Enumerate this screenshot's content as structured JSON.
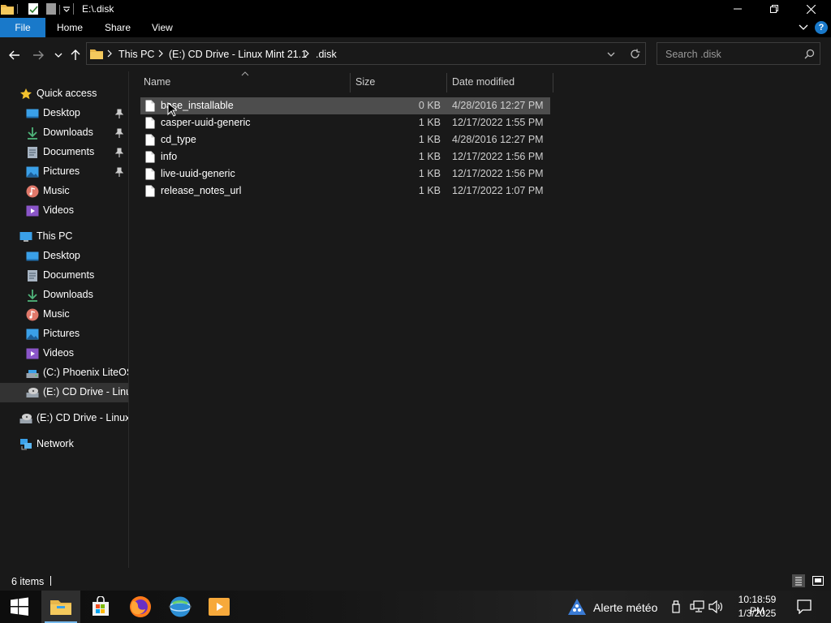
{
  "window": {
    "title": "E:\\.disk"
  },
  "ribbon": {
    "tabs": [
      {
        "label": "File"
      },
      {
        "label": "Home"
      },
      {
        "label": "Share"
      },
      {
        "label": "View"
      }
    ],
    "help_label": "?"
  },
  "address": {
    "crumbs": [
      {
        "label": "This PC"
      },
      {
        "label": "(E:) CD Drive - Linux Mint 21.1"
      },
      {
        "label": ".disk"
      }
    ]
  },
  "search": {
    "placeholder": "Search .disk",
    "value": ""
  },
  "navpane": {
    "quick_access": {
      "label": "Quick access"
    },
    "quick_items": [
      {
        "label": "Desktop",
        "icon": "desktop-icon",
        "pinned": true
      },
      {
        "label": "Downloads",
        "icon": "downloads-icon",
        "pinned": true
      },
      {
        "label": "Documents",
        "icon": "documents-icon",
        "pinned": true
      },
      {
        "label": "Pictures",
        "icon": "pictures-icon",
        "pinned": true
      },
      {
        "label": "Music",
        "icon": "music-icon",
        "pinned": false
      },
      {
        "label": "Videos",
        "icon": "videos-icon",
        "pinned": false
      }
    ],
    "this_pc": {
      "label": "This PC"
    },
    "pc_items": [
      {
        "label": "Desktop",
        "icon": "desktop-icon"
      },
      {
        "label": "Documents",
        "icon": "documents-icon"
      },
      {
        "label": "Downloads",
        "icon": "downloads-icon"
      },
      {
        "label": "Music",
        "icon": "music-icon"
      },
      {
        "label": "Pictures",
        "icon": "pictures-icon"
      },
      {
        "label": "Videos",
        "icon": "videos-icon"
      },
      {
        "label": "(C:) Phoenix LiteOS",
        "icon": "drive-icon"
      },
      {
        "label": "(E:) CD Drive - Linux",
        "icon": "cd-drive-icon",
        "selected": true
      }
    ],
    "cd_drive": {
      "label": "(E:) CD Drive - Linux I"
    },
    "network": {
      "label": "Network"
    }
  },
  "columns": {
    "name": "Name",
    "size": "Size",
    "date": "Date modified"
  },
  "files": [
    {
      "name": "base_installable",
      "size": "0 KB",
      "date": "4/28/2016 12:27 PM"
    },
    {
      "name": "casper-uuid-generic",
      "size": "1 KB",
      "date": "12/17/2022 1:55 PM"
    },
    {
      "name": "cd_type",
      "size": "1 KB",
      "date": "4/28/2016 12:27 PM"
    },
    {
      "name": "info",
      "size": "1 KB",
      "date": "12/17/2022 1:56 PM"
    },
    {
      "name": "live-uuid-generic",
      "size": "1 KB",
      "date": "12/17/2022 1:56 PM"
    },
    {
      "name": "release_notes_url",
      "size": "1 KB",
      "date": "12/17/2022 1:07 PM"
    }
  ],
  "status": {
    "count": "6 items"
  },
  "taskbar": {
    "weather": "Alerte météo",
    "time": "10:18:59 PM",
    "date": "1/3/2025"
  },
  "colors": {
    "accent": "#1979ca",
    "background": "#191919",
    "selected": "#333333",
    "hover_row": "#4d4d4d"
  }
}
